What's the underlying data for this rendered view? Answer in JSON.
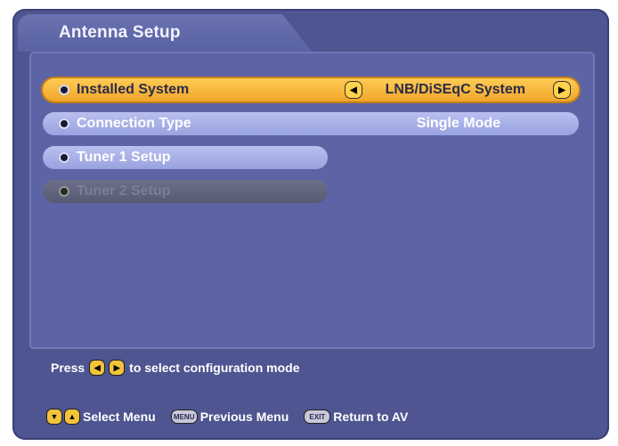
{
  "screen": {
    "title": "Antenna Setup"
  },
  "menu": {
    "items": [
      {
        "label": "Installed System",
        "value": "LNB/DiSEqC System",
        "state": "selected"
      },
      {
        "label": "Connection Type",
        "value": "Single Mode",
        "state": "normal"
      },
      {
        "label": "Tuner 1 Setup",
        "value": "",
        "state": "normal"
      },
      {
        "label": "Tuner 2 Setup",
        "value": "",
        "state": "disabled"
      }
    ]
  },
  "hint": {
    "prefix": "Press",
    "suffix": "to select configuration mode"
  },
  "footer": {
    "select_menu": "Select Menu",
    "menu_key": "MENU",
    "previous_menu": "Previous Menu",
    "exit_key": "EXIT",
    "return_to_av": "Return to AV"
  },
  "colors": {
    "background": "#4e5590",
    "selected": "#f0a52a",
    "item": "#98a2de",
    "disabled": "#575a73",
    "key": "#f3c43a"
  }
}
